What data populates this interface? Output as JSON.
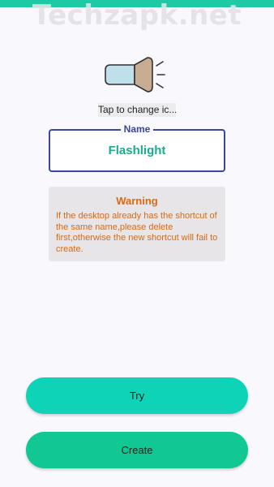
{
  "watermark": "Techzapk.net",
  "icon": {
    "name": "flashlight-icon"
  },
  "change_icon_label": "Tap to change ic...",
  "name_field": {
    "legend": "Name",
    "value": "Flashlight"
  },
  "warning": {
    "title": "Warning",
    "text": "If the desktop already has the shortcut of the same name,please delete first,otherwise the new shortcut will fail to create."
  },
  "buttons": {
    "try_label": "Try",
    "create_label": "Create"
  },
  "colors": {
    "accent": "#1ec9a6",
    "name_border": "#3b4898",
    "name_value": "#17ad8e",
    "warning_text": "#d96a13",
    "try_button": "#0fd3b6",
    "create_button": "#12c892"
  }
}
